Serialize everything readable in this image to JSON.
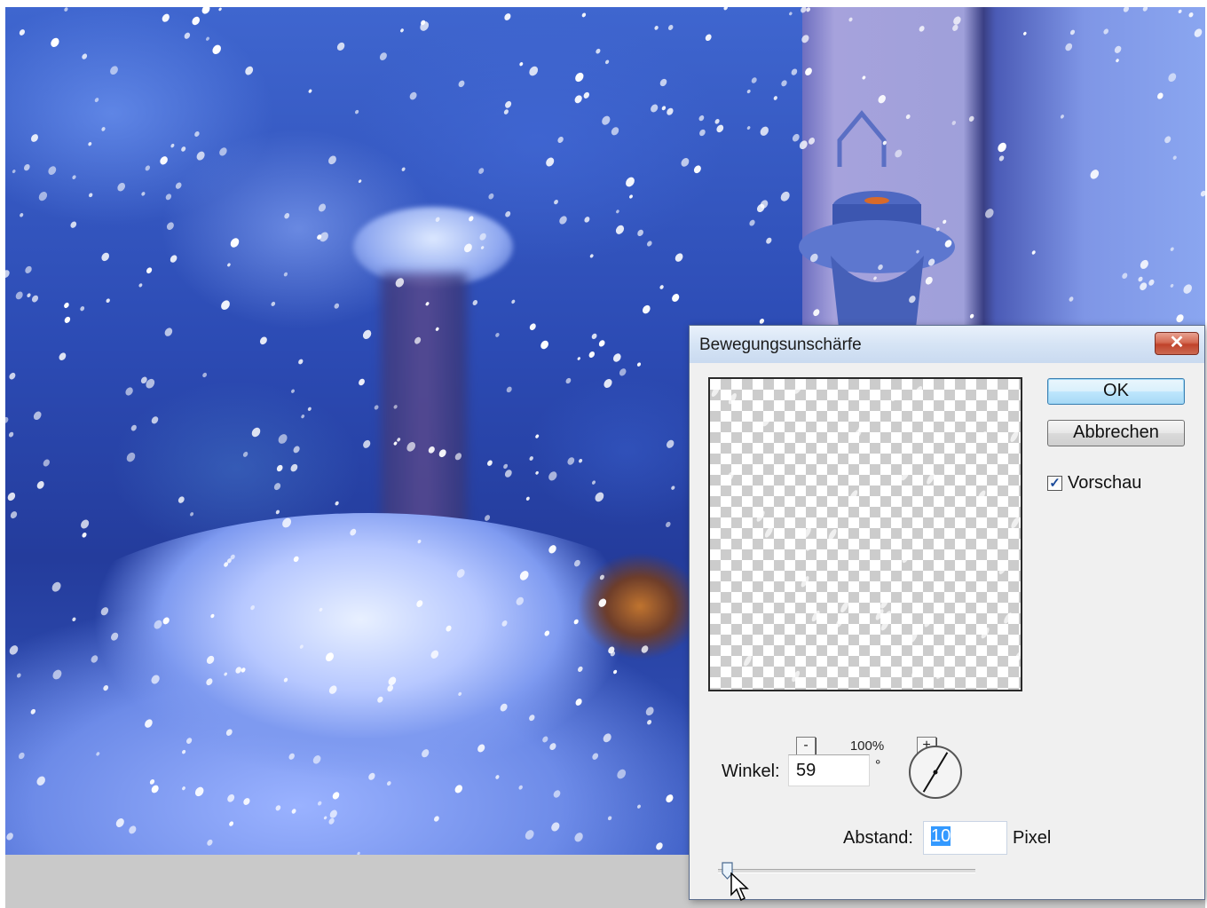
{
  "dialog": {
    "title": "Bewegungsunschärfe",
    "close_label": "✕",
    "ok_label": "OK",
    "cancel_label": "Abbrechen",
    "preview_checkbox": {
      "label": "Vorschau",
      "checked": true
    },
    "zoom": {
      "minus_label": "-",
      "level": "100%",
      "plus_label": "+"
    },
    "angle": {
      "label": "Winkel:",
      "value": "59",
      "unit": "°"
    },
    "distance": {
      "label": "Abstand:",
      "value": "10",
      "unit": "Pixel"
    }
  },
  "icons": {
    "close": "close-icon",
    "angle_dial": "angle-dial-icon",
    "slider_thumb": "slider-thumb-icon",
    "cursor": "mouse-pointer-icon"
  },
  "colors": {
    "ok_button_border": "#3c7fb1",
    "close_button": "#c0432b",
    "selection": "#3399ff"
  }
}
